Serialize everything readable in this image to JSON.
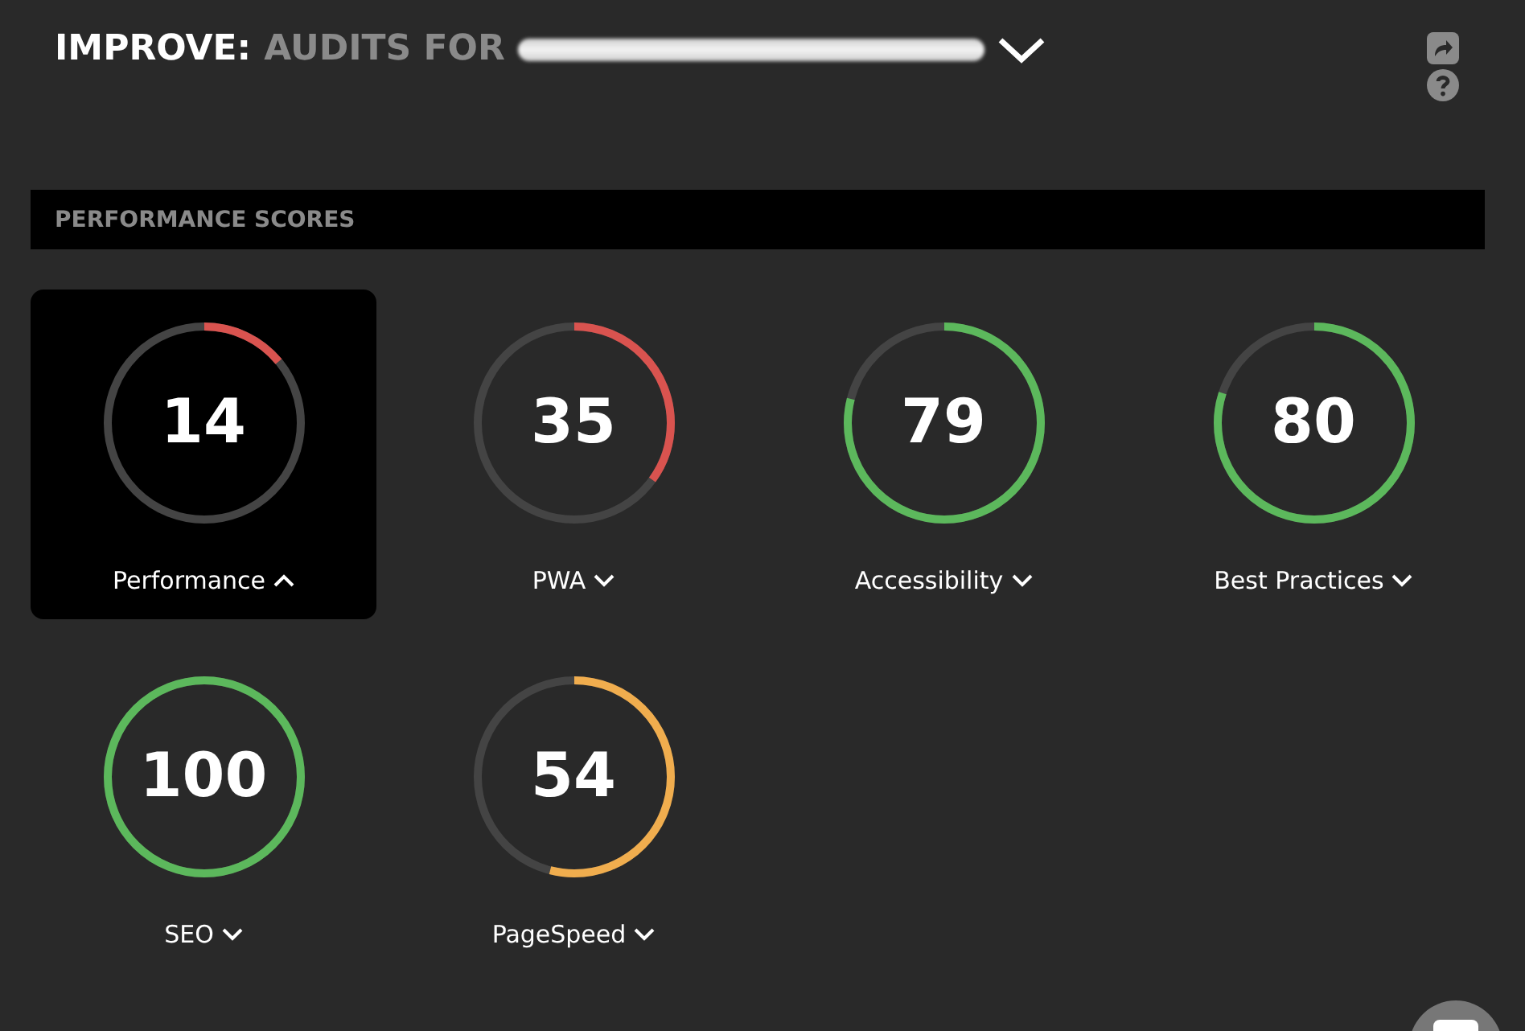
{
  "header": {
    "title": "IMPROVE:",
    "subtitle": "AUDITS FOR"
  },
  "section": {
    "title": "PERFORMANCE SCORES"
  },
  "scores": [
    {
      "label": "Performance",
      "score": "14",
      "level": 0.14,
      "color": "#d9534f",
      "selected": true
    },
    {
      "label": "PWA",
      "score": "35",
      "level": 0.35,
      "color": "#d9534f",
      "selected": false
    },
    {
      "label": "Accessibility",
      "score": "79",
      "level": 0.79,
      "color": "#5cb85c",
      "selected": false
    },
    {
      "label": "Best Practices",
      "score": "80",
      "level": 0.8,
      "color": "#5cb85c",
      "selected": false
    },
    {
      "label": "SEO",
      "score": "100",
      "level": 1.0,
      "color": "#5cb85c",
      "selected": false
    },
    {
      "label": "PageSpeed",
      "score": "54",
      "level": 0.54,
      "color": "#f0ad4e",
      "selected": false
    }
  ]
}
